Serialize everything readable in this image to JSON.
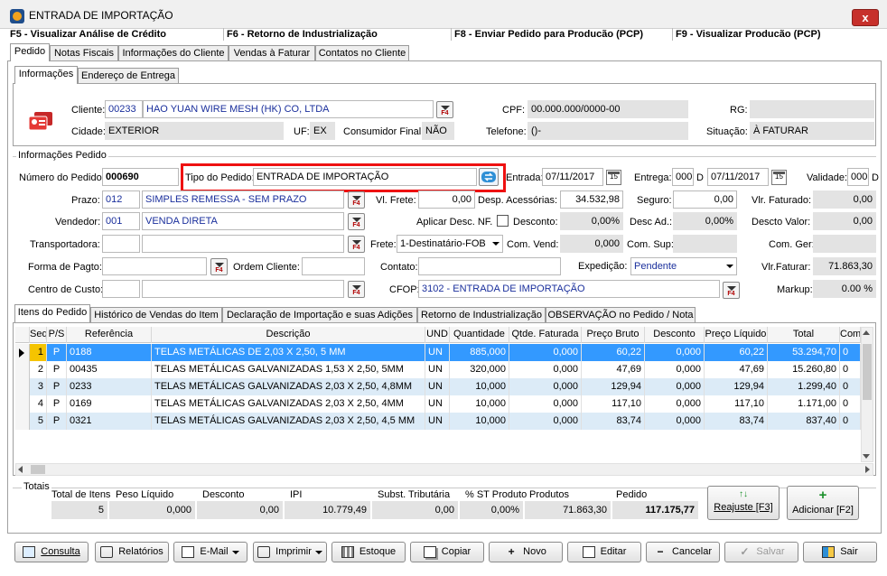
{
  "window": {
    "title": "ENTRADA DE IMPORTAÇÃO",
    "close": "x"
  },
  "fkeys": [
    "F5 - Visualizar Análise de Crédito",
    "F6 - Retorno de Industrialização",
    "F8 - Enviar Pedido para Producão (PCP)",
    "F9 - Visualizar Producão (PCP)"
  ],
  "main_tabs": [
    "Pedido",
    "Notas Fiscais",
    "Informações do Cliente",
    "Vendas à Faturar",
    "Contatos no Cliente"
  ],
  "sub_tabs": [
    "Informações",
    "Endereço de Entrega"
  ],
  "client": {
    "cliente_label": "Cliente:",
    "cliente_code": "00233",
    "cliente_name": "HAO YUAN WIRE MESH (HK) CO, LTDA",
    "cpf_label": "CPF:",
    "cpf_value": "00.000.000/0000-00",
    "rg_label": "RG:",
    "rg_value": "",
    "cidade_label": "Cidade:",
    "cidade_value": "EXTERIOR",
    "uf_label": "UF:",
    "uf_value": "EX",
    "consumidor_label": "Consumidor Final:",
    "consumidor_value": "NÃO",
    "telefone_label": "Telefone:",
    "telefone_value": "()-",
    "situacao_label": "Situação:",
    "situacao_value": "À FATURAR"
  },
  "pedido": {
    "group_title": "Informações Pedido",
    "numero_label": "Número do Pedido:",
    "numero_value": "000690",
    "tipo_label": "Tipo do Pedido:",
    "tipo_value": "ENTRADA DE IMPORTAÇÃO",
    "entrada_label": "Entrada:",
    "entrada_value": "07/11/2017",
    "d_label": "D",
    "entrega_label": "Entrega:",
    "entrega_days": "000",
    "entrega_date": "07/11/2017",
    "validade_label": "Validade:",
    "validade_days": "000",
    "prazo_label": "Prazo:",
    "prazo_code": "012",
    "prazo_name": "SIMPLES REMESSA - SEM PRAZO",
    "vendedor_label": "Vendedor:",
    "vendedor_code": "001",
    "vendedor_name": "VENDA DIRETA",
    "transportadora_label": "Transportadora:",
    "forma_label": "Forma de Pagto:",
    "ordem_label": "Ordem Cliente:",
    "centro_label": "Centro de Custo:",
    "vlfrete_label": "Vl. Frete:",
    "vlfrete_value": "0,00",
    "desp_label": "Desp. Acessórias:",
    "desp_value": "34.532,98",
    "seguro_label": "Seguro:",
    "seguro_value": "0,00",
    "vlfaturado_label": "Vlr. Faturado:",
    "vlfaturado_value": "0,00",
    "aplicar_label": "Aplicar Desc. NF.",
    "desconto_label": "Desconto:",
    "desconto_value": "0,00%",
    "descad_label": "Desc Ad.:",
    "descad_value": "0,00%",
    "descvalor_label": "Descto Valor:",
    "descvalor_value": "0,00",
    "frete_label": "Frete:",
    "frete_value": "1-Destinatário-FOB",
    "comvend_label": "Com. Vend:",
    "comvend_value": "0,000",
    "comsup_label": "Com. Sup:",
    "comsup_value": "",
    "comger_label": "Com. Ger:",
    "comger_value": "",
    "contato_label": "Contato:",
    "expedicao_label": "Expedição:",
    "expedicao_value": "Pendente",
    "vlfaturar_label": "Vlr.Faturar:",
    "vlfaturar_value": "71.863,30",
    "cfop_label": "CFOP:",
    "cfop_value": "3102 - ENTRADA DE IMPORTAÇÃO",
    "markup_label": "Markup:",
    "markup_value": "0.00 %"
  },
  "item_tabs": [
    "Itens do Pedido",
    "Histórico de Vendas do Item",
    "Declaração de Importação e suas Adições",
    "Retorno de Industrialização",
    "OBSERVAÇÃO no Pedido / Nota"
  ],
  "grid": {
    "headers": [
      "Seq",
      "P/S",
      "Referência",
      "Descrição",
      "UND",
      "Quantidade",
      "Qtde. Faturada",
      "Preço Bruto",
      "Desconto",
      "Preço Líquido",
      "Total",
      "Com"
    ],
    "rows": [
      [
        "1",
        "P",
        "0188",
        "TELAS METÁLICAS DE 2,03 X 2,50, 5 MM",
        "UN",
        "885,000",
        "0,000",
        "60,22",
        "0,000",
        "60,22",
        "53.294,70",
        "0"
      ],
      [
        "2",
        "P",
        "00435",
        "TELAS METÁLICAS GALVANIZADAS 1,53 X 2,50, 5MM",
        "UN",
        "320,000",
        "0,000",
        "47,69",
        "0,000",
        "47,69",
        "15.260,80",
        "0"
      ],
      [
        "3",
        "P",
        "0233",
        "TELAS METÁLICAS GALVANIZADAS 2,03 X 2,50, 4,8MM",
        "UN",
        "10,000",
        "0,000",
        "129,94",
        "0,000",
        "129,94",
        "1.299,40",
        "0"
      ],
      [
        "4",
        "P",
        "0169",
        "TELAS METÁLICAS GALVANIZADAS 2,03 X 2,50, 4MM",
        "UN",
        "10,000",
        "0,000",
        "117,10",
        "0,000",
        "117,10",
        "1.171,00",
        "0"
      ],
      [
        "5",
        "P",
        "0321",
        "TELAS METÁLICAS GALVANIZADAS 2,03 X 2,50, 4,5 MM",
        "UN",
        "10,000",
        "0,000",
        "83,74",
        "0,000",
        "83,74",
        "837,40",
        "0"
      ]
    ]
  },
  "totals": {
    "title": "Totais",
    "labels": [
      "Total de Itens",
      "Peso Líquido",
      "Desconto",
      "IPI",
      "Subst. Tributária",
      "% ST Produto",
      "Produtos",
      "Pedido"
    ],
    "values": [
      "5",
      "0,000",
      "0,00",
      "10.779,49",
      "0,00",
      "0,00%",
      "71.863,30",
      "117.175,77"
    ],
    "reajuste": "Reajuste [F3]",
    "adicionar": "Adicionar [F2]"
  },
  "buttons": [
    "Consulta",
    "Relatórios",
    "E-Mail",
    "Imprimir",
    "Estoque",
    "Copiar",
    "Novo",
    "Editar",
    "Cancelar",
    "Salvar",
    "Sair"
  ],
  "icons": {
    "f4": "F4",
    "cal": "15",
    "plus": "+",
    "minus": "−",
    "check": "✓",
    "arrows": "↑↓"
  },
  "colors": {
    "selected_row": "#3399ff",
    "alt_row": "#dcebf7",
    "highlight": "#e11111",
    "link_blue": "#1a2f9c"
  }
}
